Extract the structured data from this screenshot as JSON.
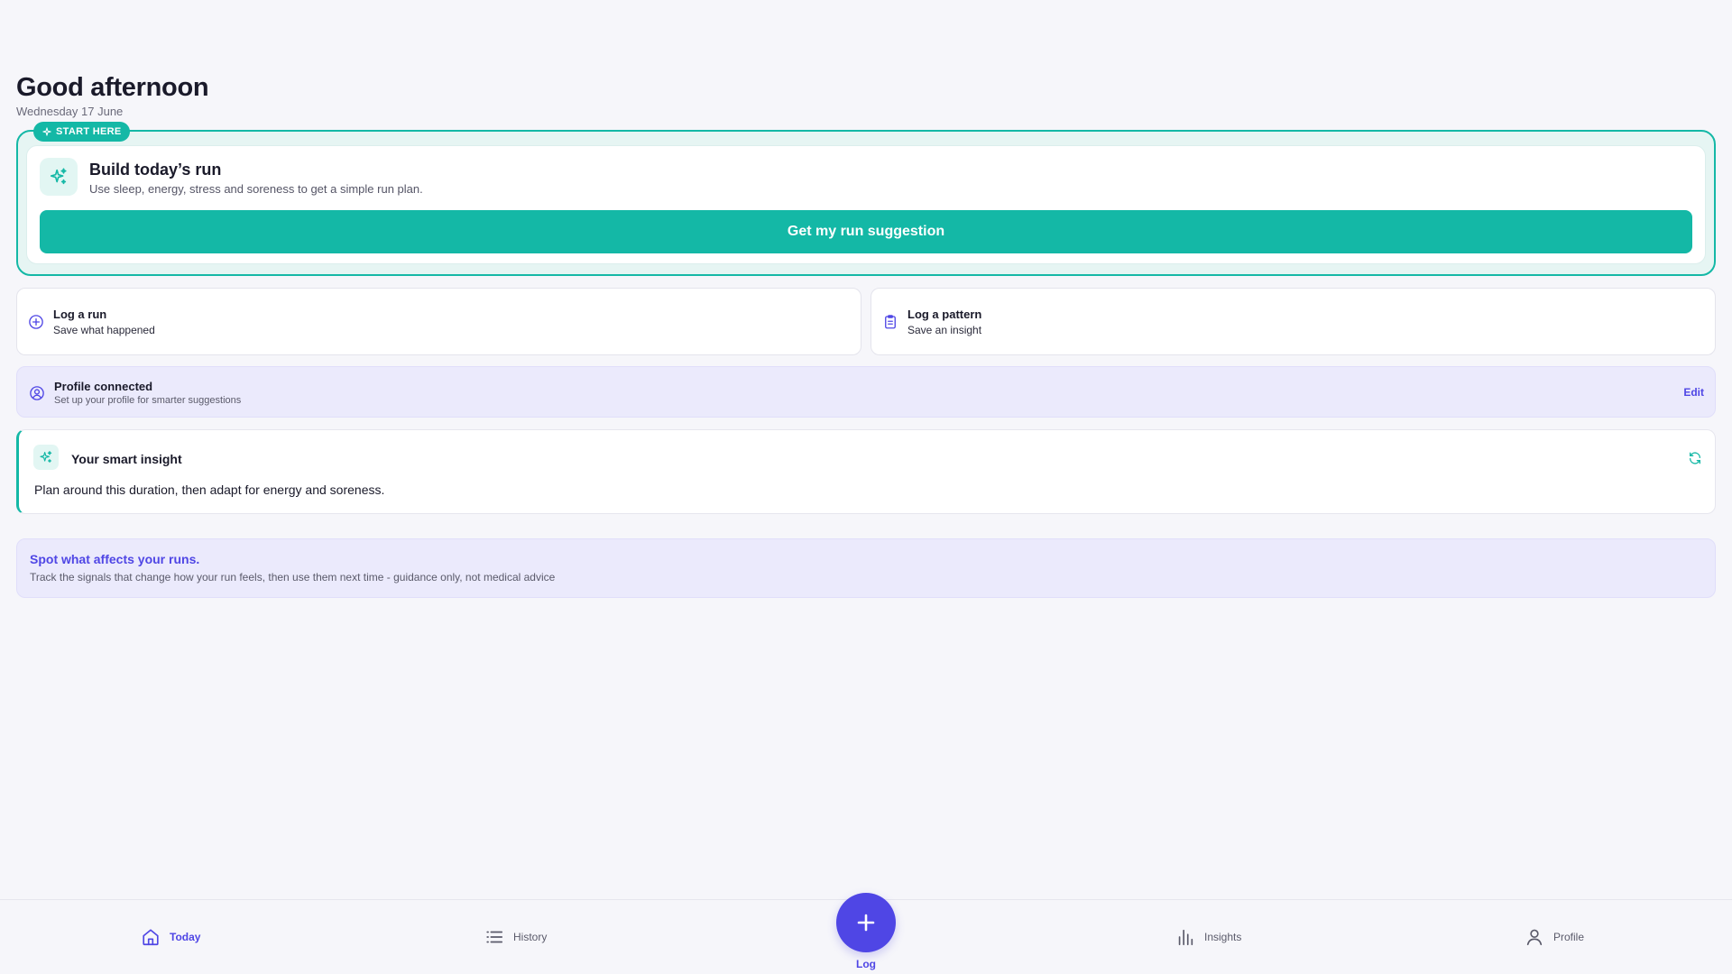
{
  "header": {
    "greeting": "Good afternoon",
    "date": "Wednesday 17 June"
  },
  "start_card": {
    "badge": "START HERE",
    "title": "Build today’s run",
    "description": "Use sleep, energy, stress and soreness to get a simple run plan.",
    "button_label": "Get my run suggestion",
    "icon": "sparkles-icon"
  },
  "actions": [
    {
      "title": "Log a run",
      "subtitle": "Save what happened",
      "icon": "plus-circle-icon"
    },
    {
      "title": "Log a pattern",
      "subtitle": "Save an insight",
      "icon": "clipboard-icon"
    }
  ],
  "profile_banner": {
    "title": "Profile connected",
    "subtitle": "Set up your profile for smarter suggestions",
    "edit_label": "Edit",
    "icon": "user-circle-icon"
  },
  "insight": {
    "title": "Your smart insight",
    "body": "Plan around this duration, then adapt for energy and soreness.",
    "icon": "sparkles-icon",
    "refresh_icon": "refresh-icon"
  },
  "tip": {
    "title": "Spot what affects your runs.",
    "subtitle": "Track the signals that change how your run feels, then use them next time - guidance only, not medical advice"
  },
  "nav": {
    "today": "Today",
    "history": "History",
    "log": "Log",
    "insights": "Insights",
    "profile": "Profile",
    "active": "Today"
  },
  "colors": {
    "teal": "#14b8a6",
    "indigo": "#4f46e5",
    "background": "#f6f6fa",
    "lavender": "#ebeafc"
  }
}
